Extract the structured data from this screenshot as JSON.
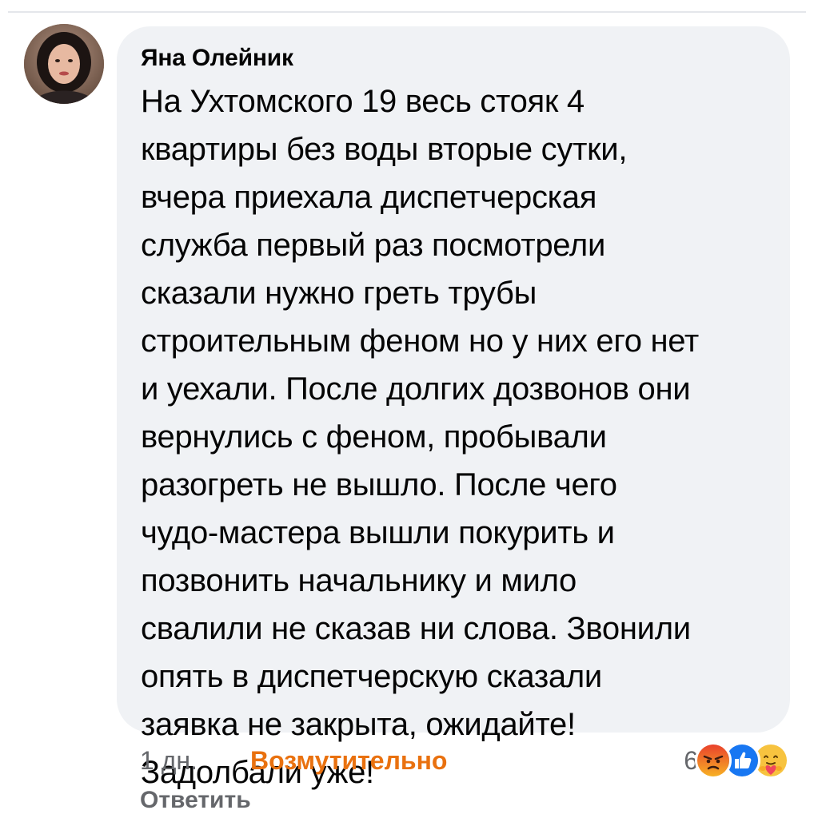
{
  "comment": {
    "author": "Яна Олейник",
    "text_lines": [
      "На Ухтомского 19 весь стояк 4",
      "квартиры без воды вторые сутки,",
      "вчера приехала диспетчерская",
      "служба первый раз посмотрели",
      "сказали нужно греть трубы",
      "строительным феном но у них его нет",
      "и уехали. После долгих дозвонов они",
      "вернулись с феном, пробывали",
      "разогреть не вышло. После чего",
      "чудо-мастера вышли покурить и",
      "позвонить начальнику и мило",
      "свалили не сказав ни слова. Звонили",
      "опять в диспетчерскую сказали",
      "заявка не закрыта, ожидайте!",
      "Задолбали уже!"
    ],
    "time": "1 дн.",
    "my_reaction": "Возмутительно",
    "reaction_count": "6",
    "reaction_icons": [
      "angry-icon",
      "like-icon",
      "care-icon"
    ],
    "reply_label": "Ответить"
  },
  "colors": {
    "bubble_bg": "#f0f2f5",
    "text": "#050505",
    "muted": "#65676b",
    "angry_accent": "#e9710f",
    "like_blue": "#1877f2"
  }
}
